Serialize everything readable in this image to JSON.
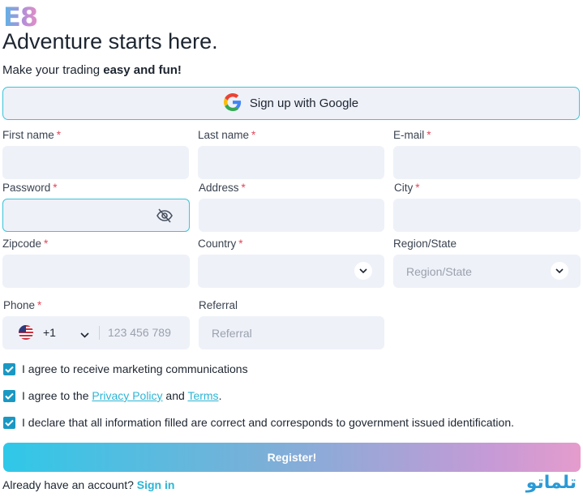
{
  "logo": "E8",
  "header": {
    "title": "Adventure starts here.",
    "subtitle_prefix": "Make your trading ",
    "subtitle_bold": "easy and fun!"
  },
  "google_button": {
    "label": "Sign up with Google",
    "icon": "google-icon"
  },
  "required_mark": "*",
  "fields": {
    "first_name": {
      "label": "First name",
      "value": ""
    },
    "last_name": {
      "label": "Last name",
      "value": ""
    },
    "email": {
      "label": "E-mail",
      "value": ""
    },
    "password": {
      "label": "Password",
      "value": "",
      "icon": "eye-slash-icon"
    },
    "address": {
      "label": "Address",
      "value": ""
    },
    "city": {
      "label": "City",
      "value": ""
    },
    "zipcode": {
      "label": "Zipcode",
      "value": ""
    },
    "country": {
      "label": "Country",
      "value": ""
    },
    "region": {
      "label": "Region/State",
      "placeholder": "Region/State"
    },
    "phone": {
      "label": "Phone",
      "country_code": "+1",
      "flag": "us-flag-icon",
      "placeholder": "123 456 789"
    },
    "referral": {
      "label": "Referral",
      "placeholder": "Referral"
    }
  },
  "checkboxes": [
    {
      "text": "I agree to receive marketing communications",
      "checked": true
    },
    {
      "prefix": "I agree to the ",
      "link1": "Privacy Policy",
      "middle": " and ",
      "link2": "Terms",
      "suffix": ".",
      "checked": true
    },
    {
      "text": "I declare that all information filled are correct and corresponds to government issued identification.",
      "checked": true
    }
  ],
  "register_button": {
    "label": "Register!"
  },
  "footer": {
    "prefix": "Already have an account?",
    "link": "Sign in"
  },
  "watermark": "تلماتو",
  "colors": {
    "accent": "#3cc4d8",
    "link": "#2bb5d6",
    "checkbox": "#1a98c4",
    "field_bg": "#eef1f8",
    "required": "#e0475a"
  }
}
